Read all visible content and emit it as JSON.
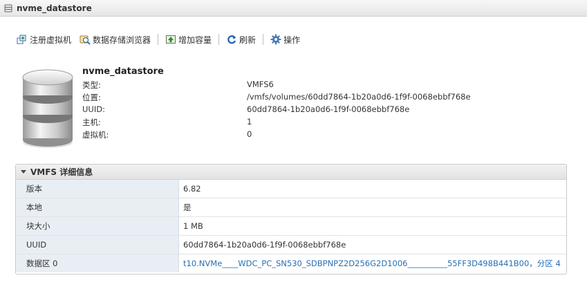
{
  "window": {
    "title": "nvme_datastore"
  },
  "toolbar": {
    "register_vm": "注册虚拟机",
    "datastore_browser": "数据存储浏览器",
    "increase_capacity": "增加容量",
    "refresh": "刷新",
    "actions": "操作"
  },
  "summary": {
    "name": "nvme_datastore",
    "rows": [
      {
        "label": "类型:",
        "value": "VMFS6"
      },
      {
        "label": "位置:",
        "value": "/vmfs/volumes/60dd7864-1b20a0d6-1f9f-0068ebbf768e"
      },
      {
        "label": "UUID:",
        "value": "60dd7864-1b20a0d6-1f9f-0068ebbf768e"
      },
      {
        "label": "主机:",
        "value": "1"
      },
      {
        "label": "虚拟机:",
        "value": "0"
      }
    ]
  },
  "vmfs_panel": {
    "title": "VMFS 详细信息",
    "rows": [
      {
        "key": "版本",
        "value": "6.82"
      },
      {
        "key": "本地",
        "value": "是"
      },
      {
        "key": "块大小",
        "value": "1 MB"
      },
      {
        "key": "UUID",
        "value": "60dd7864-1b20a0d6-1f9f-0068ebbf768e"
      },
      {
        "key": "数据区 0",
        "value": "t10.NVMe____WDC_PC_SN530_SDBPNPZ2D256G2D1006__________55FF3D498B441B00，分区 4"
      }
    ]
  },
  "colors": {
    "link": "#2a6fb4",
    "key_cell_bg": "#e8eef4"
  },
  "icons": {
    "title": "datastore-icon",
    "register_vm": "register-vm-icon",
    "datastore_browser": "datastore-browser-icon",
    "increase_capacity": "increase-capacity-icon",
    "refresh": "refresh-icon",
    "actions": "gear-icon",
    "summary": "database-icon"
  }
}
